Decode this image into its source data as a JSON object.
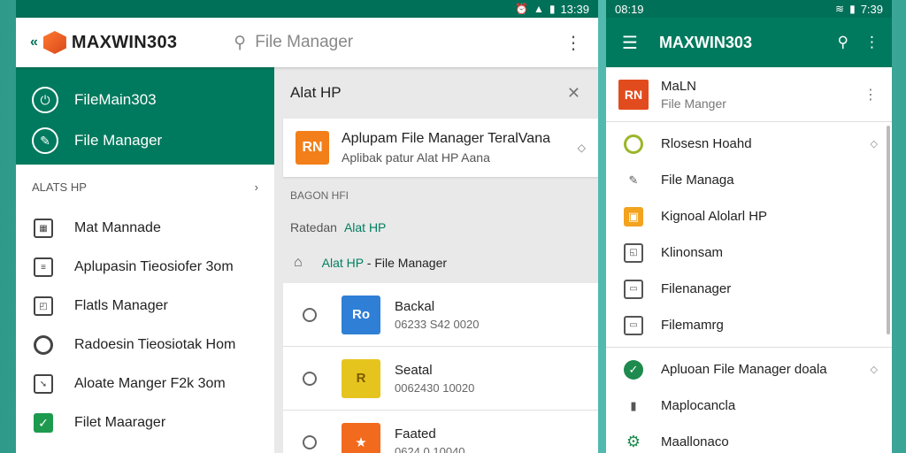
{
  "screen1": {
    "status": {
      "time": "13:39"
    },
    "appbar": {
      "brand": "MAXWIN303",
      "search_placeholder": "File Manager"
    },
    "drawer": {
      "header_items": [
        {
          "label": "FileMain303"
        },
        {
          "label": "File Manager"
        }
      ],
      "section_title": "ALATS HP",
      "items": [
        {
          "label": "Mat Mannade",
          "icon": "calendar-icon"
        },
        {
          "label": "Aplupasin Tieosiofer 3om",
          "icon": "document-icon"
        },
        {
          "label": "Flatls Manager",
          "icon": "box-icon"
        },
        {
          "label": "Radoesin Tieosiotak Hom",
          "icon": "ring-icon"
        },
        {
          "label": "Aloate Manger F2k 3om",
          "icon": "arrow-box-icon"
        },
        {
          "label": "Filet Maarager",
          "icon": "check-icon"
        }
      ]
    },
    "content": {
      "title": "Alat HP",
      "feature": {
        "logo": "RN",
        "title": "Aplupam File Manager TeralVana",
        "subtitle": "Aplibak patur Alat HP Aana"
      },
      "section_small": "BAGON HFI",
      "ratedan_prefix": "Ratedan",
      "ratedan_link": "Alat HP",
      "path_link": "Alat HP",
      "path_rest": "- File Manager",
      "files": [
        {
          "name": "Backal",
          "meta": "06233 S42 0020",
          "thumb": "Ro",
          "color": "#2f7fd6"
        },
        {
          "name": "Seatal",
          "meta": "0062430 10020",
          "thumb": "R",
          "color": "#e6c41e"
        },
        {
          "name": "Faated",
          "meta": "0624 0 10040",
          "thumb": "★",
          "color": "#f26a1e"
        }
      ]
    }
  },
  "screen2": {
    "status": {
      "time": "7:39",
      "left_time": "08:19"
    },
    "appbar": {
      "brand": "MAXWIN303"
    },
    "account": {
      "logo": "RN",
      "name": "MaLN",
      "subtitle": "File Manger"
    },
    "items": [
      {
        "label": "Rlosesn Hoahd",
        "icon": "olive-ring-icon",
        "chevron": true
      },
      {
        "label": "File Managa",
        "icon": "pin-icon"
      },
      {
        "label": "Kignoal Alolarl HP",
        "icon": "amber-box-icon"
      },
      {
        "label": "Klinonsam",
        "icon": "box-icon"
      },
      {
        "label": "Filenanager",
        "icon": "folder-tag-icon"
      },
      {
        "label": "Filemamrg",
        "icon": "folder-icon"
      }
    ],
    "items_lower": [
      {
        "label": "Apluoan File Manager doala",
        "icon": "green-check-icon",
        "chevron": true
      },
      {
        "label": "Maplocancla",
        "icon": "save-icon"
      },
      {
        "label": "Maallonaco",
        "icon": "gear-icon"
      }
    ]
  }
}
